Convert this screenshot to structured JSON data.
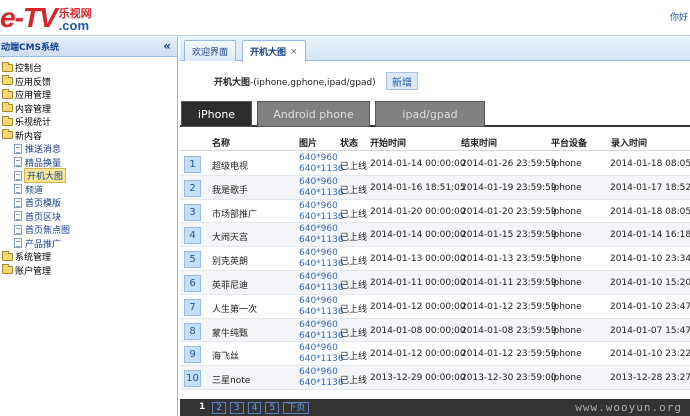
{
  "header": {
    "logo_main": "e-TV",
    "logo_cn": "乐视网",
    "logo_com": ".com",
    "greeting": "你好"
  },
  "sidebar": {
    "title": "动端CMS系统",
    "collapse_icon": "«",
    "items": [
      {
        "label": "控制台",
        "level": 1,
        "icon": "folder-icon"
      },
      {
        "label": "应用反馈",
        "level": 1,
        "icon": "folder-icon"
      },
      {
        "label": "应用管理",
        "level": 1,
        "icon": "folder-icon"
      },
      {
        "label": "内容管理",
        "level": 1,
        "icon": "folder-icon"
      },
      {
        "label": "乐视统计",
        "level": 1,
        "icon": "folder-icon"
      },
      {
        "label": "新内容",
        "level": 1,
        "icon": "folder-open-icon"
      },
      {
        "label": "推送消息",
        "level": 2,
        "icon": "document-icon"
      },
      {
        "label": "精品换量",
        "level": 2,
        "icon": "document-icon"
      },
      {
        "label": "开机大图",
        "level": 2,
        "icon": "document-icon",
        "selected": true
      },
      {
        "label": "频道",
        "level": 2,
        "icon": "document-icon"
      },
      {
        "label": "首页模版",
        "level": 2,
        "icon": "document-icon"
      },
      {
        "label": "首页区块",
        "level": 2,
        "icon": "document-icon"
      },
      {
        "label": "首页焦点图",
        "level": 2,
        "icon": "document-icon"
      },
      {
        "label": "产品推广",
        "level": 2,
        "icon": "document-icon"
      },
      {
        "label": "系统管理",
        "level": 1,
        "icon": "folder-icon"
      },
      {
        "label": "账户管理",
        "level": 1,
        "icon": "folder-icon"
      }
    ]
  },
  "tabs": [
    {
      "label": "欢迎界面"
    },
    {
      "label": "开机大图",
      "close": "×"
    }
  ],
  "page": {
    "title": "开机大图",
    "subtitle": "-(iphone,gphone,ipad/gpad)",
    "add_label": "新增"
  },
  "platform_tabs": [
    "iPhone",
    "Android phone",
    "ipad/gpad"
  ],
  "table": {
    "headers": [
      "名称",
      "图片",
      "状态",
      "开始时间",
      "结束时间",
      "平台设备",
      "录入时间"
    ],
    "rows": [
      {
        "num": "1",
        "name": "超级电视",
        "pic1": "640*960",
        "pic2": "640*1136",
        "state": "已上线",
        "start": "2014-01-14 00:00:00",
        "end": "2014-01-26 23:59:59",
        "plat": "iphone",
        "rec": "2014-01-18 08:05"
      },
      {
        "num": "2",
        "name": "我是歌手",
        "pic1": "640*960",
        "pic2": "640*1136",
        "state": "已上线",
        "start": "2014-01-16 18:51:05",
        "end": "2014-01-19 23:59:59",
        "plat": "iphone",
        "rec": "2014-01-17 18:52"
      },
      {
        "num": "3",
        "name": "市场部推广",
        "pic1": "640*960",
        "pic2": "640*1136",
        "state": "已上线",
        "start": "2014-01-20 00:00:00",
        "end": "2014-01-20 23:59:59",
        "plat": "iphone",
        "rec": "2014-01-18 08:05"
      },
      {
        "num": "4",
        "name": "大闹天宫",
        "pic1": "640*960",
        "pic2": "640*1136",
        "state": "已上线",
        "start": "2014-01-14 00:00:00",
        "end": "2014-01-15 23:59:59",
        "plat": "iphone",
        "rec": "2014-01-14 16:18"
      },
      {
        "num": "5",
        "name": "别克英朗",
        "pic1": "640*960",
        "pic2": "640*1136",
        "state": "已上线",
        "start": "2014-01-13 00:00:00",
        "end": "2014-01-13 23:59:59",
        "plat": "iphone",
        "rec": "2014-01-10 23:34"
      },
      {
        "num": "6",
        "name": "英菲尼迪",
        "pic1": "640*960",
        "pic2": "640*1136",
        "state": "已上线",
        "start": "2014-01-11 00:00:00",
        "end": "2014-01-11 23:59:59",
        "plat": "iphone",
        "rec": "2014-01-10 15:20"
      },
      {
        "num": "7",
        "name": "人生第一次",
        "pic1": "640*960",
        "pic2": "640*1136",
        "state": "已上线",
        "start": "2014-01-12 00:00:00",
        "end": "2014-01-12 23:59:59",
        "plat": "iphone",
        "rec": "2014-01-10 23:47"
      },
      {
        "num": "8",
        "name": "蒙牛纯甄",
        "pic1": "640*960",
        "pic2": "640*1136",
        "state": "已上线",
        "start": "2014-01-08 00:00:00",
        "end": "2014-01-08 23:59:59",
        "plat": "iphone",
        "rec": "2014-01-07 15:47"
      },
      {
        "num": "9",
        "name": "海飞丝",
        "pic1": "640*960",
        "pic2": "640*1136",
        "state": "已上线",
        "start": "2014-01-12 00:00:00",
        "end": "2014-01-12 23:59:59",
        "plat": "iphone",
        "rec": "2014-01-10 23:22"
      },
      {
        "num": "10",
        "name": "三星note",
        "pic1": "640*960",
        "pic2": "640*1136",
        "state": "已上线",
        "start": "2013-12-29 00:00:00",
        "end": "2013-12-30 23:59:00",
        "plat": "iphone",
        "rec": "2013-12-28 23:27"
      }
    ]
  },
  "pager": {
    "pages": [
      "1",
      "2",
      "3",
      "4",
      "5"
    ],
    "next": "下页"
  },
  "watermark": "www.wooyun.org",
  "colors": {
    "accent": "#15428b",
    "brand_red": "#d8242b",
    "tab_dark": "#2d2d2d",
    "tab_gray": "#808080"
  }
}
